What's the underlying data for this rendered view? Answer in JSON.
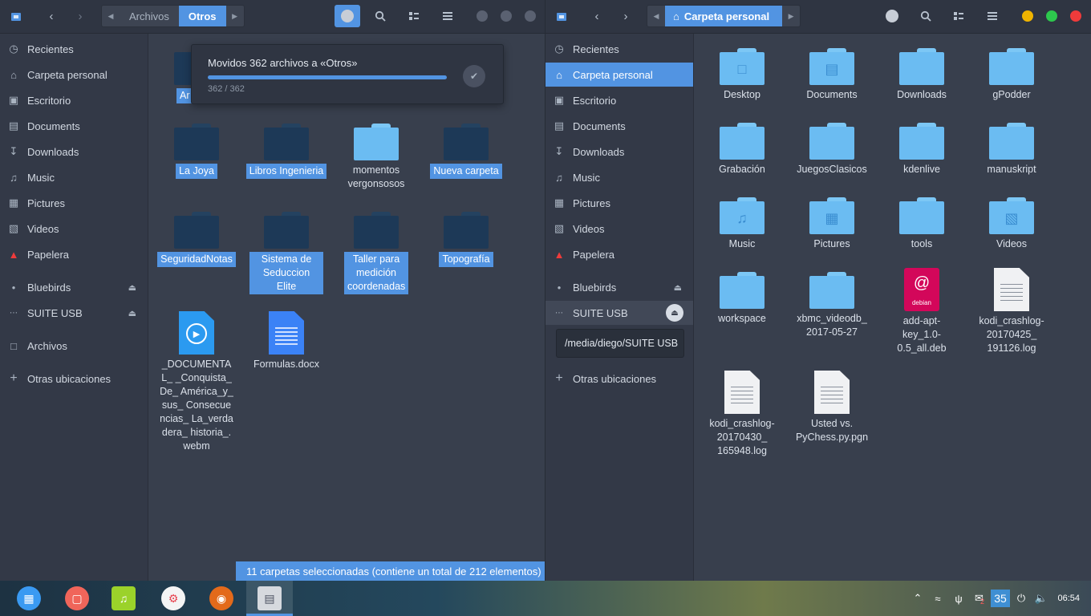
{
  "left": {
    "pathbar": {
      "segments": [
        "Archivos",
        "Otros"
      ]
    },
    "sidebar": [
      {
        "label": "Recientes",
        "icon": "clock-icon"
      },
      {
        "label": "Carpeta personal",
        "icon": "home-icon"
      },
      {
        "label": "Escritorio",
        "icon": "desktop-icon"
      },
      {
        "label": "Documents",
        "icon": "document-icon"
      },
      {
        "label": "Downloads",
        "icon": "download-icon"
      },
      {
        "label": "Music",
        "icon": "music-icon"
      },
      {
        "label": "Pictures",
        "icon": "picture-icon"
      },
      {
        "label": "Videos",
        "icon": "video-icon"
      },
      {
        "label": "Papelera",
        "icon": "trash-icon"
      },
      {
        "label": "Bluebirds",
        "icon": "drive-icon"
      },
      {
        "label": "SUITE USB",
        "icon": "usb-icon"
      },
      {
        "label": "Archivos",
        "icon": "folder-icon"
      },
      {
        "label": "Otras ubicaciones",
        "icon": "plus-icon"
      }
    ],
    "files": [
      {
        "label": "Ar"
      },
      {
        "label": "La Joya"
      },
      {
        "label": "Libros Ingenieria"
      },
      {
        "label": "momentos vergonsosos"
      },
      {
        "label": "Nueva carpeta"
      },
      {
        "label": "SeguridadNotas"
      },
      {
        "label": "Sistema de Seduccion Elite"
      },
      {
        "label": "Taller para medición coordenadas"
      },
      {
        "label": "Topografía"
      },
      {
        "label": "_DOCUMENTAL_ _Conquista_De_ América_y_sus_ Consecuencias_ La_verdadera_ historia_.webm"
      },
      {
        "label": "Formulas.docx"
      }
    ],
    "popover": {
      "message": "Movidos 362 archivos a «Otros»",
      "count": "362 / 362",
      "progress": 1.0
    },
    "status": "11 carpetas seleccionadas  (contiene un total de 212 elementos)"
  },
  "right": {
    "pathbar": {
      "segments": [
        "Carpeta personal"
      ]
    },
    "sidebar": [
      {
        "label": "Recientes",
        "icon": "clock-icon"
      },
      {
        "label": "Carpeta personal",
        "icon": "home-icon"
      },
      {
        "label": "Escritorio",
        "icon": "desktop-icon"
      },
      {
        "label": "Documents",
        "icon": "document-icon"
      },
      {
        "label": "Downloads",
        "icon": "download-icon"
      },
      {
        "label": "Music",
        "icon": "music-icon"
      },
      {
        "label": "Pictures",
        "icon": "picture-icon"
      },
      {
        "label": "Videos",
        "icon": "video-icon"
      },
      {
        "label": "Papelera",
        "icon": "trash-icon"
      },
      {
        "label": "Bluebirds",
        "icon": "drive-icon"
      },
      {
        "label": "SUITE USB",
        "icon": "usb-icon"
      },
      {
        "label": "Otras ubicaciones",
        "icon": "plus-icon"
      }
    ],
    "tooltip": "/media/diego/SUITE USB",
    "files": [
      {
        "label": "Desktop"
      },
      {
        "label": "Documents"
      },
      {
        "label": "Downloads"
      },
      {
        "label": "gPodder"
      },
      {
        "label": "Grabación"
      },
      {
        "label": "JuegosClasicos"
      },
      {
        "label": "kdenlive"
      },
      {
        "label": "manuskript"
      },
      {
        "label": "Music"
      },
      {
        "label": "Pictures"
      },
      {
        "label": "tools"
      },
      {
        "label": "Videos"
      },
      {
        "label": "workspace"
      },
      {
        "label": "xbmc_videodb_ 2017-05-27"
      },
      {
        "label": "add-apt-key_1.0- 0.5_all.deb",
        "badge": "debian"
      },
      {
        "label": "kodi_crashlog- 20170425_ 191126.log"
      },
      {
        "label": "kodi_crashlog- 20170430_ 165948.log"
      },
      {
        "label": "Usted vs. PyChess.py.pgn"
      }
    ]
  },
  "taskbar": {
    "workspace": "35",
    "clock": "06:54",
    "notif_count": "2"
  },
  "colors": {
    "accent": "#5294e2",
    "window_bg": "#383f4d",
    "sidebar_bg": "#333947",
    "header_bg": "#2f3542",
    "btn_yellow": "#f0b400",
    "btn_green": "#2dc84d",
    "btn_red": "#ef3b3b"
  }
}
